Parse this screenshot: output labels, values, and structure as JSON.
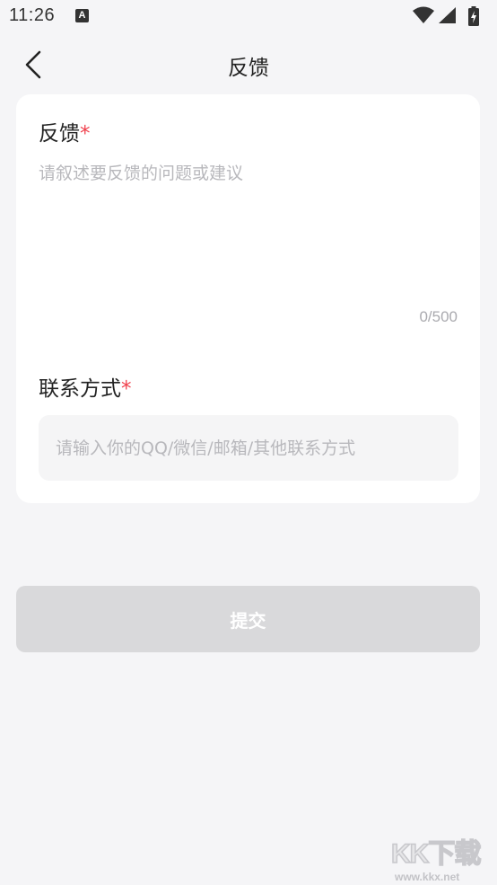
{
  "status_bar": {
    "time": "11:26",
    "notification_icon": "A",
    "icons": [
      "wifi-icon",
      "signal-icon",
      "battery-charging-icon"
    ]
  },
  "nav": {
    "back_icon": "chevron-left-icon",
    "title": "反馈"
  },
  "feedback": {
    "label": "反馈",
    "required_mark": "*",
    "placeholder": "请叙述要反馈的问题或建议",
    "value": "",
    "char_count": "0/500"
  },
  "contact": {
    "label": "联系方式",
    "required_mark": "*",
    "placeholder": "请输入你的QQ/微信/邮箱/其他联系方式",
    "value": ""
  },
  "submit": {
    "label": "提交",
    "enabled": false
  },
  "watermark": {
    "text": "KK下载",
    "url": "www.kkx.net"
  },
  "colors": {
    "background": "#f5f5f7",
    "card": "#ffffff",
    "required": "#f0414d",
    "placeholder": "#b8b8bc",
    "button_disabled": "#d9d9db",
    "input_bg": "#f5f5f6"
  }
}
